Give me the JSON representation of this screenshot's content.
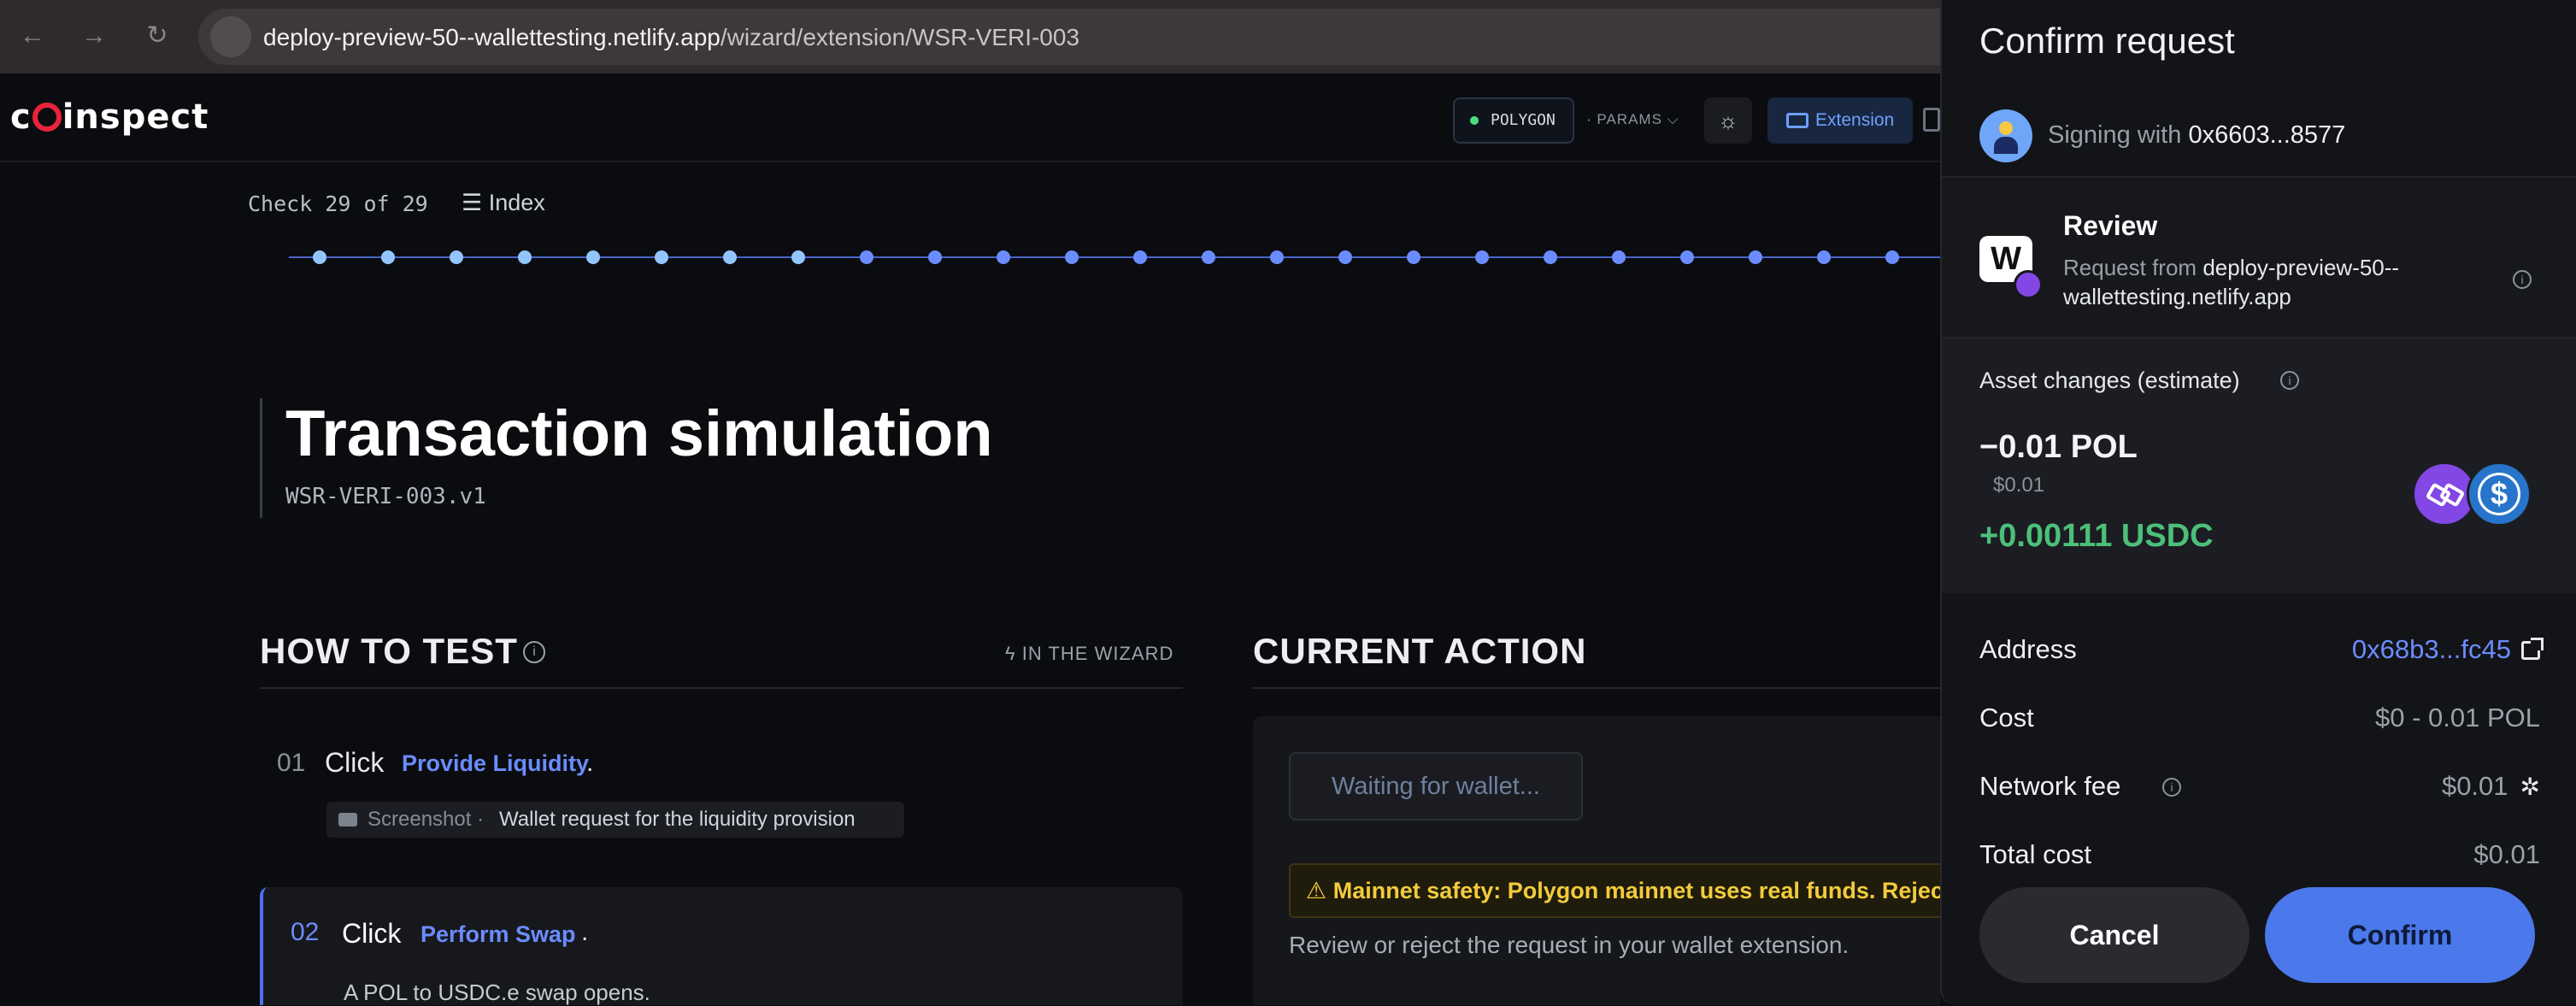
{
  "browser": {
    "back_icon": "arrow-left-icon",
    "forward_icon": "arrow-right-icon",
    "reload_icon": "reload-icon",
    "url_host": "deploy-preview-50--wallettesting.netlify.app",
    "url_path": "/wizard/extension/WSR-VERI-003"
  },
  "header": {
    "logo_pre": "c",
    "logo_post": "inspect",
    "network": "POLYGON",
    "params": "· PARAMS ⌵",
    "theme_icon": "sun-icon",
    "extension_label": "Extension"
  },
  "progress": {
    "check_label": "Check 29 of 29",
    "index_label": "☰ Index",
    "visible_dots": 24,
    "completed_dots": 8,
    "colors": {
      "line": "#4a63c9",
      "done": "#93c5fd",
      "pending": "#6b8cff"
    }
  },
  "page": {
    "title": "Transaction simulation",
    "subtitle": "WSR-VERI-003.v1"
  },
  "how_to_test": {
    "heading": "HOW TO TEST",
    "wizard_tag": "ϟ IN THE WIZARD",
    "steps": [
      {
        "num": "01",
        "verb": "Click",
        "link": "Provide Liquidity",
        "end": ".",
        "screenshot_label": "Screenshot ·",
        "screenshot_desc": "Wallet request for the liquidity provision"
      },
      {
        "num": "02",
        "verb": "Click",
        "link": "Perform Swap",
        "end": ".",
        "desc": "A POL to USDC.e swap opens."
      }
    ]
  },
  "current_action": {
    "heading": "CURRENT ACTION",
    "waiting_button": "Waiting for wallet...",
    "warning": "⚠ Mainnet safety: Polygon mainnet uses real funds. Reject",
    "note": "Review or reject the request in your wallet extension."
  },
  "wallet": {
    "title": "Confirm request",
    "signing_prefix": "Signing with",
    "signing_address": "0x6603...8577",
    "review_title": "Review",
    "request_from_prefix": "Request from",
    "request_from_host": "deploy-preview-50--wallettesting.netlify.app",
    "assets_label": "Asset changes (estimate)",
    "outgoing_amount": "−0.01 POL",
    "outgoing_usd": "$0.01",
    "incoming_amount": "+0.00111 USDC",
    "usdc_symbol": "$",
    "rows": {
      "address_label": "Address",
      "address_value": "0x68b3...fc45",
      "cost_label": "Cost",
      "cost_value": "$0 - 0.01 POL",
      "fee_label": "Network fee",
      "fee_value": "$0.01",
      "total_label": "Total cost",
      "total_value": "$0.01"
    },
    "cancel_label": "Cancel",
    "confirm_label": "Confirm",
    "colors": {
      "confirm": "#4b78ea",
      "positive": "#4cc07a",
      "link": "#6b8cff"
    }
  }
}
